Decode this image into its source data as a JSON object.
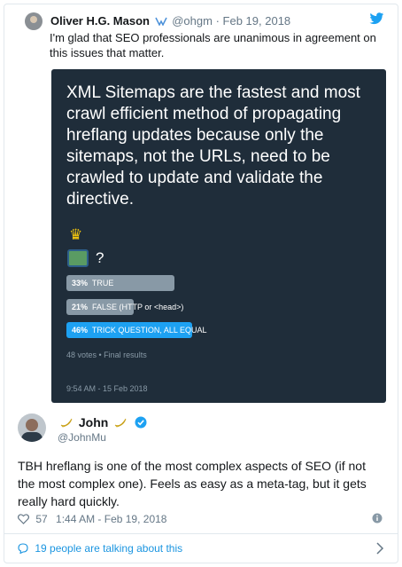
{
  "quoted_tweet": {
    "name": "Oliver H.G. Mason",
    "handle": "@ohgm",
    "separator": "·",
    "date": "Feb 19, 2018",
    "text": "I'm glad that SEO professionals are unanimous in agreement on this issues that matter."
  },
  "poll": {
    "question": "XML Sitemaps are the fastest and most crawl efficient method of propagating hreflang updates because only the sitemaps, not the URLs, need to be crawled to update and validate the directive.",
    "emoji_line_2_text": "?",
    "options": [
      {
        "percent": "33%",
        "label": "TRUE",
        "share": 0.33,
        "color": "#8899a6"
      },
      {
        "percent": "21%",
        "label": "FALSE (HTTP or <head>)",
        "share": 0.21,
        "color": "#8899a6"
      },
      {
        "percent": "46%",
        "label": "TRICK QUESTION, ALL EQUAL",
        "share": 0.46,
        "color": "#1da1f2"
      }
    ],
    "summary": "48 votes • Final results",
    "timestamp": "9:54 AM - 15 Feb 2018"
  },
  "tweet": {
    "name": "John",
    "handle": "@JohnMu",
    "text": "TBH hreflang is one of the most complex aspects of SEO (if not the most complex one). Feels as easy as a meta-tag, but it gets really hard quickly.",
    "likes": "57",
    "timestamp": "1:44 AM - Feb 19, 2018"
  },
  "footer": {
    "talking": "19 people are talking about this"
  },
  "colors": {
    "twitter_blue": "#1da1f2",
    "panel_bg": "#1f2d3a",
    "muted": "#657786"
  },
  "icons": [
    "twitter-icon",
    "verified-icon",
    "banana-icon",
    "heart-icon",
    "info-icon",
    "talk-icon",
    "chevron-right-icon"
  ]
}
